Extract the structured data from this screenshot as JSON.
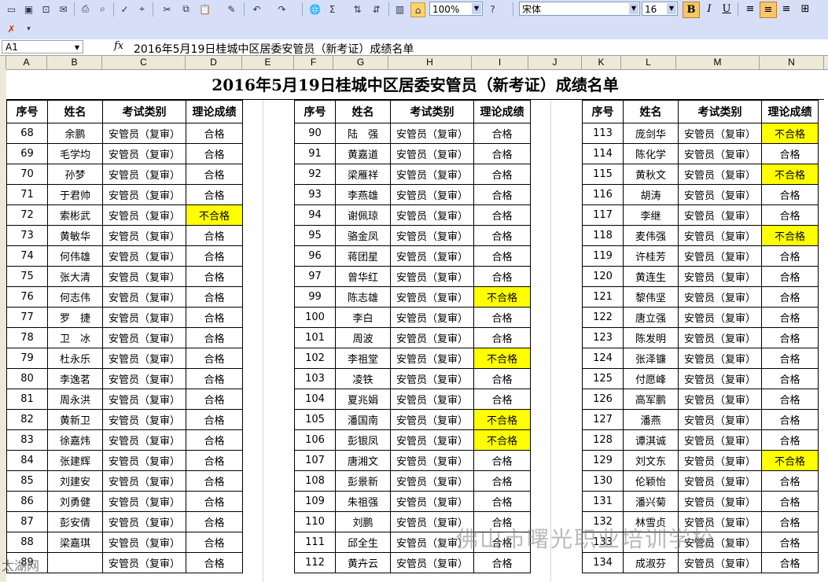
{
  "toolbar": {
    "zoom": "100%",
    "font_name": "宋体",
    "font_size": "16",
    "bold_label": "B",
    "italic_label": "I",
    "underline_label": "U"
  },
  "formula_bar": {
    "cell_ref": "A1",
    "fx_label": "fx",
    "content": "2016年5月19日桂城中区居委安管员（新考证）成绩名单"
  },
  "columns": [
    "A",
    "B",
    "C",
    "D",
    "E",
    "F",
    "G",
    "H",
    "I",
    "J",
    "K",
    "L",
    "M",
    "N"
  ],
  "sheet": {
    "title": "2016年5月19日桂城中区居委安管员（新考证）成绩名单",
    "headers": [
      "序号",
      "姓名",
      "考试类别",
      "理论成绩"
    ],
    "fail_color": "#ffff00",
    "blocks": [
      [
        [
          "68",
          "余鹏",
          "安管员（复审）",
          "合格"
        ],
        [
          "69",
          "毛学均",
          "安管员（复审）",
          "合格"
        ],
        [
          "70",
          "孙梦",
          "安管员（复审）",
          "合格"
        ],
        [
          "71",
          "于君帅",
          "安管员（复审）",
          "合格"
        ],
        [
          "72",
          "索彬武",
          "安管员（复审）",
          "不合格"
        ],
        [
          "73",
          "黄敏华",
          "安管员（复审）",
          "合格"
        ],
        [
          "74",
          "何伟雄",
          "安管员（复审）",
          "合格"
        ],
        [
          "75",
          "张大清",
          "安管员（复审）",
          "合格"
        ],
        [
          "76",
          "何志伟",
          "安管员（复审）",
          "合格"
        ],
        [
          "77",
          "罗　捷",
          "安管员（复审）",
          "合格"
        ],
        [
          "78",
          "卫　冰",
          "安管员（复审）",
          "合格"
        ],
        [
          "79",
          "杜永乐",
          "安管员（复审）",
          "合格"
        ],
        [
          "80",
          "李逸茗",
          "安管员（复审）",
          "合格"
        ],
        [
          "81",
          "周永洪",
          "安管员（复审）",
          "合格"
        ],
        [
          "82",
          "黄新卫",
          "安管员（复审）",
          "合格"
        ],
        [
          "83",
          "徐嘉炜",
          "安管员（复审）",
          "合格"
        ],
        [
          "84",
          "张建辉",
          "安管员（复审）",
          "合格"
        ],
        [
          "85",
          "刘建安",
          "安管员（复审）",
          "合格"
        ],
        [
          "86",
          "刘勇健",
          "安管员（复审）",
          "合格"
        ],
        [
          "87",
          "彭安倩",
          "安管员（复审）",
          "合格"
        ],
        [
          "88",
          "梁嘉琪",
          "安管员（复审）",
          "合格"
        ],
        [
          "89",
          "",
          "安管员（复审）",
          "合格"
        ]
      ],
      [
        [
          "90",
          "陆　强",
          "安管员（复审）",
          "合格"
        ],
        [
          "91",
          "黄嘉道",
          "安管员（复审）",
          "合格"
        ],
        [
          "92",
          "梁雁祥",
          "安管员（复审）",
          "合格"
        ],
        [
          "93",
          "李燕雄",
          "安管员（复审）",
          "合格"
        ],
        [
          "94",
          "谢佩琼",
          "安管员（复审）",
          "合格"
        ],
        [
          "95",
          "骆金凤",
          "安管员（复审）",
          "合格"
        ],
        [
          "96",
          "蒋团星",
          "安管员（复审）",
          "合格"
        ],
        [
          "97",
          "曾华红",
          "安管员（复审）",
          "合格"
        ],
        [
          "99",
          "陈志雄",
          "安管员（复审）",
          "不合格"
        ],
        [
          "100",
          "李白",
          "安管员（复审）",
          "合格"
        ],
        [
          "101",
          "周波",
          "安管员（复审）",
          "合格"
        ],
        [
          "102",
          "李祖堂",
          "安管员（复审）",
          "不合格"
        ],
        [
          "103",
          "凌铁",
          "安管员（复审）",
          "合格"
        ],
        [
          "104",
          "夏兆娟",
          "安管员（复审）",
          "合格"
        ],
        [
          "105",
          "潘国南",
          "安管员（复审）",
          "不合格"
        ],
        [
          "106",
          "彭银凤",
          "安管员（复审）",
          "不合格"
        ],
        [
          "107",
          "唐湘文",
          "安管员（复审）",
          "合格"
        ],
        [
          "108",
          "彭景新",
          "安管员（复审）",
          "合格"
        ],
        [
          "109",
          "朱祖强",
          "安管员（复审）",
          "合格"
        ],
        [
          "110",
          "刘鹏",
          "安管员（复审）",
          "合格"
        ],
        [
          "111",
          "邱全生",
          "安管员（复审）",
          "合格"
        ],
        [
          "112",
          "黄卉云",
          "安管员（复审）",
          "合格"
        ]
      ],
      [
        [
          "113",
          "庞剑华",
          "安管员（复审）",
          "不合格"
        ],
        [
          "114",
          "陈化学",
          "安管员（复审）",
          "合格"
        ],
        [
          "115",
          "黄秋文",
          "安管员（复审）",
          "不合格"
        ],
        [
          "116",
          "胡涛",
          "安管员（复审）",
          "合格"
        ],
        [
          "117",
          "李继",
          "安管员（复审）",
          "合格"
        ],
        [
          "118",
          "麦伟强",
          "安管员（复审）",
          "不合格"
        ],
        [
          "119",
          "许桂芳",
          "安管员（复审）",
          "合格"
        ],
        [
          "120",
          "黄连生",
          "安管员（复审）",
          "合格"
        ],
        [
          "121",
          "黎伟坚",
          "安管员（复审）",
          "合格"
        ],
        [
          "122",
          "唐立强",
          "安管员（复审）",
          "合格"
        ],
        [
          "123",
          "陈发明",
          "安管员（复审）",
          "合格"
        ],
        [
          "124",
          "张泽镰",
          "安管员（复审）",
          "合格"
        ],
        [
          "125",
          "付愿峰",
          "安管员（复审）",
          "合格"
        ],
        [
          "126",
          "高军鹏",
          "安管员（复审）",
          "合格"
        ],
        [
          "127",
          "潘燕",
          "安管员（复审）",
          "合格"
        ],
        [
          "128",
          "谭淇诚",
          "安管员（复审）",
          "合格"
        ],
        [
          "129",
          "刘文东",
          "安管员（复审）",
          "不合格"
        ],
        [
          "130",
          "伦颖怡",
          "安管员（复审）",
          "合格"
        ],
        [
          "131",
          "潘兴菊",
          "安管员（复审）",
          "合格"
        ],
        [
          "132",
          "林雪贞",
          "安管员（复审）",
          "合格"
        ],
        [
          "133",
          "",
          "安管员（复审）",
          "合格"
        ],
        [
          "134",
          "成淑芬",
          "安管员（复审）",
          "合格"
        ]
      ]
    ]
  },
  "watermarks": {
    "main": "佛山市曙光职业培训学校",
    "corner": "太湖网"
  }
}
